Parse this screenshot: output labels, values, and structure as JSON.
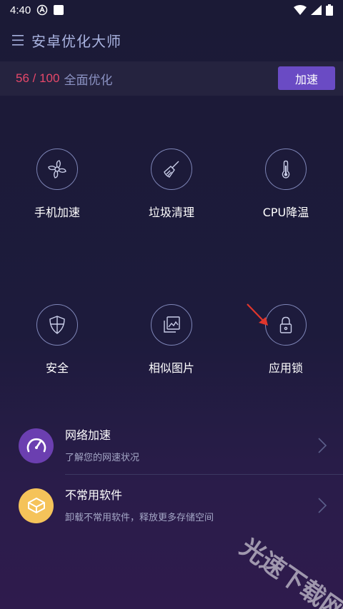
{
  "status": {
    "time": "4:40"
  },
  "appbar": {
    "title": "安卓优化大师"
  },
  "score": {
    "value": "56 / 100",
    "label": "全面优化",
    "boost_label": "加速"
  },
  "tiles": [
    {
      "label": "手机加速",
      "icon": "fan-icon"
    },
    {
      "label": "垃圾清理",
      "icon": "broom-icon"
    },
    {
      "label": "CPU降温",
      "icon": "thermometer-icon"
    },
    {
      "label": "安全",
      "icon": "shield-icon"
    },
    {
      "label": "相似图片",
      "icon": "photos-icon"
    },
    {
      "label": "应用锁",
      "icon": "lock-icon"
    }
  ],
  "list": [
    {
      "title": "网络加速",
      "subtitle": "了解您的网速状况",
      "icon": "speedometer-icon",
      "color": "#6b3fb0"
    },
    {
      "title": "不常用软件",
      "subtitle": "卸载不常用软件，释放更多存储空间",
      "icon": "box-icon",
      "color": "#f5c35a"
    }
  ],
  "watermark": {
    "text": "光速下载网"
  },
  "colors": {
    "accent": "#6a4bc4",
    "score": "#e7486a"
  }
}
